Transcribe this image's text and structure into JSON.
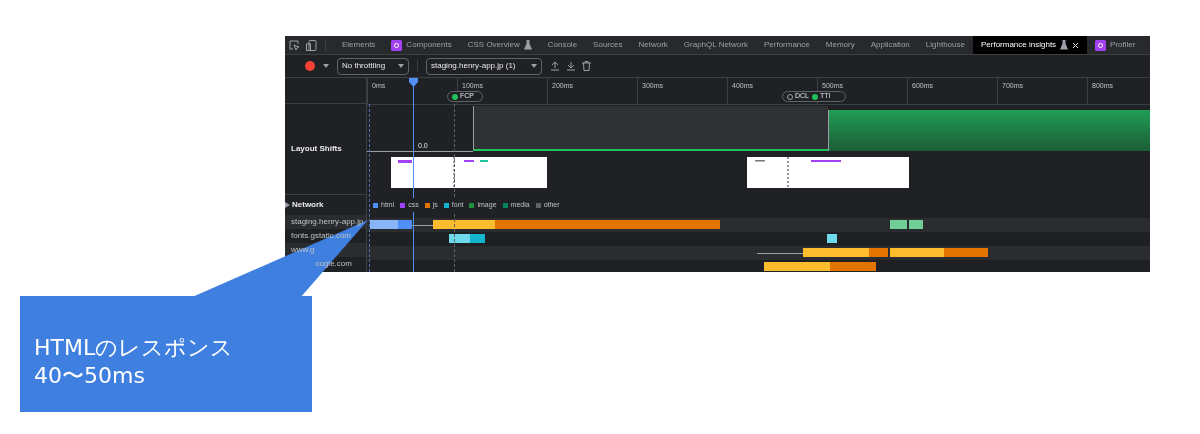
{
  "tabs": [
    {
      "label": "Elements",
      "selected": false,
      "kind": "plain"
    },
    {
      "label": "Components",
      "selected": false,
      "kind": "ext"
    },
    {
      "label": "CSS Overview",
      "selected": false,
      "kind": "flask"
    },
    {
      "label": "Console",
      "selected": false,
      "kind": "plain"
    },
    {
      "label": "Sources",
      "selected": false,
      "kind": "plain"
    },
    {
      "label": "Network",
      "selected": false,
      "kind": "plain"
    },
    {
      "label": "GraphQL Network",
      "selected": false,
      "kind": "plain"
    },
    {
      "label": "Performance",
      "selected": false,
      "kind": "plain"
    },
    {
      "label": "Memory",
      "selected": false,
      "kind": "plain"
    },
    {
      "label": "Application",
      "selected": false,
      "kind": "plain"
    },
    {
      "label": "Lighthouse",
      "selected": false,
      "kind": "plain"
    },
    {
      "label": "Performance insights",
      "selected": true,
      "kind": "flask",
      "closable": true
    },
    {
      "label": "Profiler",
      "selected": false,
      "kind": "ext"
    }
  ],
  "toolbar": {
    "recording": true,
    "throttling": "No throttling",
    "recording_select": "staging.henry-app.jp (1)"
  },
  "ruler": {
    "ticks": [
      "0ms",
      "100ms",
      "200ms",
      "300ms",
      "400ms",
      "500ms",
      "600ms",
      "700ms",
      "800ms"
    ],
    "markers": [
      {
        "label": "FCP",
        "kind": "fcp"
      },
      {
        "label": "DCL",
        "kind": "dcl"
      },
      {
        "label": "TTI",
        "kind": "tti"
      }
    ]
  },
  "layout_shifts": {
    "title": "Layout Shifts",
    "score": "0.0"
  },
  "network": {
    "title": "Network",
    "legend": [
      {
        "label": "html",
        "color": "#4f8ff7"
      },
      {
        "label": "css",
        "color": "#a142f4"
      },
      {
        "label": "js",
        "color": "#e37400"
      },
      {
        "label": "font",
        "color": "#12b5cb"
      },
      {
        "label": "image",
        "color": "#1e8e3e"
      },
      {
        "label": "media",
        "color": "#01875f"
      },
      {
        "label": "other",
        "color": "#5f6368"
      }
    ],
    "rows": [
      {
        "label": "staging.henry-app.jp"
      },
      {
        "label": "fonts.gstatic.com"
      },
      {
        "label": "www.g"
      },
      {
        "label": "oogle.com"
      }
    ]
  },
  "callout": {
    "lines": [
      "HTMLのレスポンス",
      "40〜50ms"
    ]
  }
}
